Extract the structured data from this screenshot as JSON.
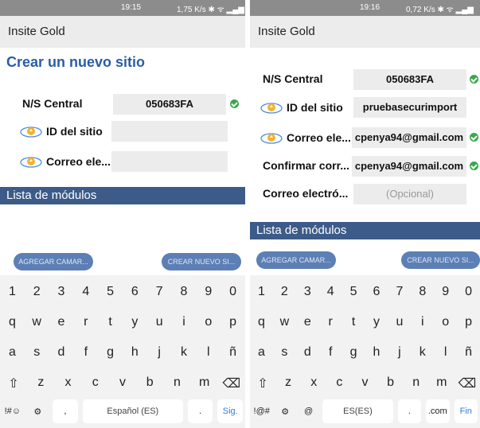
{
  "left": {
    "status": {
      "time": "19:15",
      "right": "1,75 K/s ✱ ᯤ ▂▄▆"
    },
    "appbar_title": "Insite Gold",
    "page_title": "Crear un nuevo sitio",
    "rows": [
      {
        "label": "N/S Central",
        "value": "050683FA",
        "check": true,
        "icon": false
      },
      {
        "label": "ID del sitio",
        "value": "",
        "check": false,
        "icon": true
      },
      {
        "label": "Correo ele...",
        "value": "",
        "check": false,
        "icon": true
      }
    ],
    "section_title": "Lista de módulos",
    "buttons": {
      "add_camera": "AGREGAR CAMAR...",
      "create_new": "CREAR NUEVO SI..."
    },
    "keyboard": {
      "numbers": [
        "1",
        "2",
        "3",
        "4",
        "5",
        "6",
        "7",
        "8",
        "9",
        "0"
      ],
      "row1": [
        "q",
        "w",
        "e",
        "r",
        "t",
        "y",
        "u",
        "i",
        "o",
        "p"
      ],
      "row2": [
        "a",
        "s",
        "d",
        "f",
        "g",
        "h",
        "j",
        "k",
        "l",
        "ñ"
      ],
      "row3": [
        "⇧",
        "z",
        "x",
        "c",
        "v",
        "b",
        "n",
        "m",
        "⌫"
      ],
      "bottom": {
        "sym": "!#☺",
        "settings": "⚙",
        "comma": ",",
        "space": "Español (ES)",
        "period": ".",
        "action": "Sig."
      }
    }
  },
  "right": {
    "status": {
      "time": "19:16",
      "right": "0,72 K/s ✱ ᯤ ▂▄▆"
    },
    "appbar_title": "Insite Gold",
    "rows": [
      {
        "label": "N/S Central",
        "value": "050683FA",
        "check": true,
        "icon": false
      },
      {
        "label": "ID del sitio",
        "value": "pruebasecurimport",
        "check": false,
        "icon": true
      },
      {
        "label": "Correo ele...",
        "value": "cpenya94@gmail.com",
        "check": true,
        "icon": true
      },
      {
        "label": "Confirmar corr...",
        "value": "cpenya94@gmail.com",
        "check": true,
        "icon": false
      },
      {
        "label": "Correo electró...",
        "value": "(Opcional)",
        "check": false,
        "icon": false,
        "placeholder": true
      }
    ],
    "section_title": "Lista de módulos",
    "buttons": {
      "add_camera": "AGREGAR CAMAR...",
      "create_new": "CREAR NUEVO SI..."
    },
    "keyboard": {
      "numbers": [
        "1",
        "2",
        "3",
        "4",
        "5",
        "6",
        "7",
        "8",
        "9",
        "0"
      ],
      "row1": [
        "q",
        "w",
        "e",
        "r",
        "t",
        "y",
        "u",
        "i",
        "o",
        "p"
      ],
      "row2": [
        "a",
        "s",
        "d",
        "f",
        "g",
        "h",
        "j",
        "k",
        "l",
        "ñ"
      ],
      "row3": [
        "⇧",
        "z",
        "x",
        "c",
        "v",
        "b",
        "n",
        "m",
        "⌫"
      ],
      "bottom": {
        "sym": "!@#",
        "settings": "⚙",
        "at": "@",
        "space": "ES(ES)",
        "period": ".",
        "dotcom": ".com",
        "action": "Fin"
      }
    }
  },
  "colors": {
    "accent": "#2a5da8",
    "section": "#3d5b88",
    "button": "#5c7fb5",
    "check": "#3aa84a",
    "action_key": "#3d7bd6"
  }
}
